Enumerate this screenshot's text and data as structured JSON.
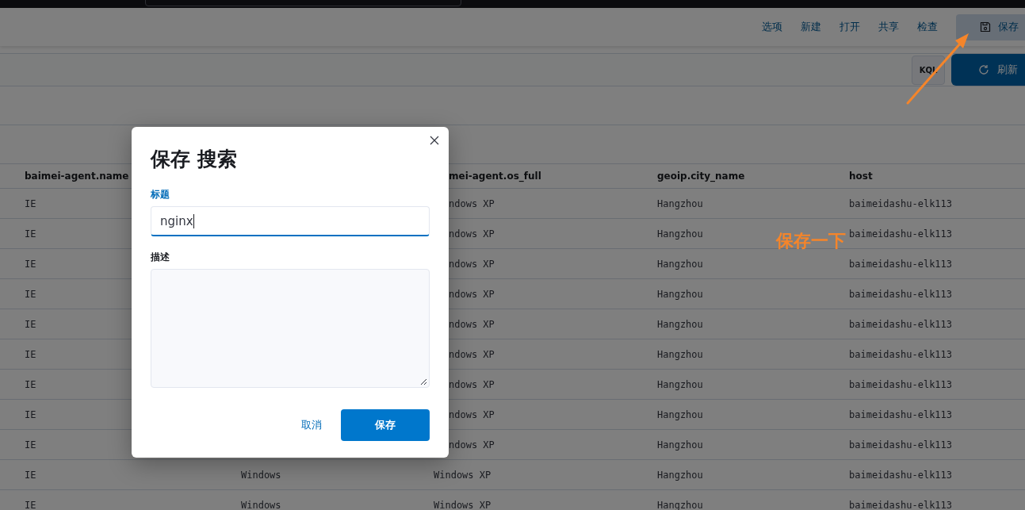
{
  "top_nav": {
    "links": [
      "选项",
      "新建",
      "打开",
      "共享",
      "检查"
    ],
    "save_button": {
      "label": "保存",
      "selected": true
    }
  },
  "query_bar": {
    "language_button": "KQL",
    "refresh_button": "刷新"
  },
  "table": {
    "columns": {
      "column_1": "baimei-agent.name",
      "column_3": "mei-agent.os_full",
      "column_4": "geoip.city_name",
      "column_5": "host"
    },
    "rows": [
      {
        "column_1": "IE",
        "column_3": "ndows XP",
        "column_4": "Hangzhou",
        "column_5": "baimeidashu-elk113"
      },
      {
        "column_1": "IE",
        "column_3": "ndows XP",
        "column_4": "Hangzhou",
        "column_5": "baimeidashu-elk113"
      },
      {
        "column_1": "IE",
        "column_3": "ndows XP",
        "column_4": "Hangzhou",
        "column_5": "baimeidashu-elk113"
      },
      {
        "column_1": "IE",
        "column_3": "ndows XP",
        "column_4": "Hangzhou",
        "column_5": "baimeidashu-elk113"
      },
      {
        "column_1": "IE",
        "column_3": "ndows XP",
        "column_4": "Hangzhou",
        "column_5": "baimeidashu-elk113"
      },
      {
        "column_1": "IE",
        "column_3": "ndows XP",
        "column_4": "Hangzhou",
        "column_5": "baimeidashu-elk113"
      },
      {
        "column_1": "IE",
        "column_3": "ndows XP",
        "column_4": "Hangzhou",
        "column_5": "baimeidashu-elk113"
      },
      {
        "column_1": "IE",
        "column_3": "ndows XP",
        "column_4": "Hangzhou",
        "column_5": "baimeidashu-elk113"
      },
      {
        "column_1": "IE",
        "column_3": "ndows XP",
        "column_4": "Hangzhou",
        "column_5": "baimeidashu-elk113"
      },
      {
        "column_1": "IE",
        "column_2": "Windows",
        "column_3": "Windows XP",
        "column_4": "Hangzhou",
        "column_5": "baimeidashu-elk113"
      },
      {
        "column_1": "IE",
        "column_2": "Windows",
        "column_3": "Windows XP",
        "column_4": "Hangzhou",
        "column_5": "baimeidashu-elk113"
      }
    ]
  },
  "dialog": {
    "title": "保存 搜索",
    "fields": [
      {
        "kind": "input",
        "label": "标题",
        "value": "nginx",
        "focused": true
      },
      {
        "kind": "textarea",
        "label": "描述",
        "focused": false
      }
    ],
    "cancel_button": "取消",
    "confirm_button": "保存"
  },
  "annotation": {
    "text": "保存一下"
  }
}
